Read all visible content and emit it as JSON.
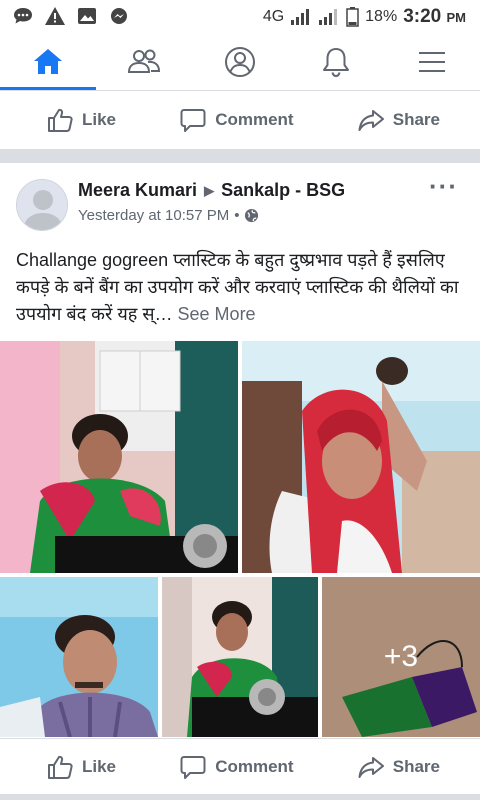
{
  "status_bar": {
    "network": "4G",
    "battery": "18%",
    "time": "3:20",
    "ampm": "PM",
    "icons": [
      "message-icon",
      "warning-icon",
      "image-icon",
      "messenger-icon"
    ]
  },
  "tabs": [
    {
      "name": "home",
      "icon": "home-icon",
      "active": true
    },
    {
      "name": "friends",
      "icon": "friends-icon",
      "active": false
    },
    {
      "name": "profile",
      "icon": "profile-icon",
      "active": false
    },
    {
      "name": "notifications",
      "icon": "bell-icon",
      "active": false
    },
    {
      "name": "menu",
      "icon": "menu-icon",
      "active": false
    }
  ],
  "actions": {
    "like": "Like",
    "comment": "Comment",
    "share": "Share"
  },
  "post": {
    "author": "Meera Kumari",
    "group": "Sankalp - BSG",
    "timestamp": "Yesterday at 10:57 PM",
    "separator": "•",
    "privacy_icon": "globe-icon",
    "text": "Challange gogreen प्लास्टिक के बहुत दुष्प्रभाव पड़ते हैं इसलिए कपड़े के बनें बैंग का उपयोग करें और करवाएं प्लास्टिक की थैलियों का उपयोग बंद करें यह स्…",
    "see_more": "See More",
    "extra_photos": "+3"
  },
  "colors": {
    "accent": "#1877f2",
    "secondary_text": "#606770",
    "divider": "#dadde1"
  }
}
